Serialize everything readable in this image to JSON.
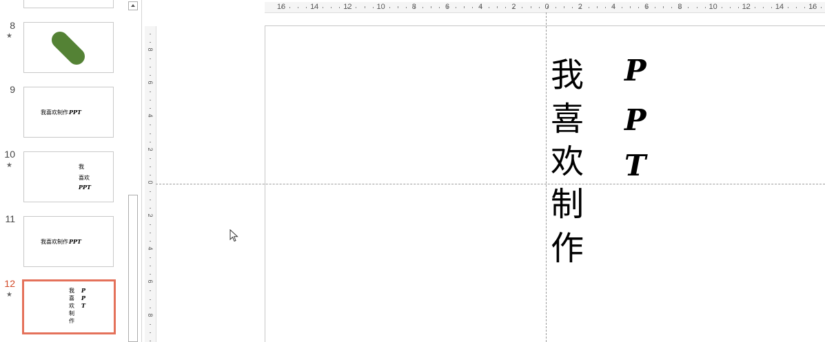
{
  "slides": [
    {
      "number": "8",
      "starred": true,
      "kind": "shape",
      "shape_color": "#548235"
    },
    {
      "number": "9",
      "starred": false,
      "kind": "text",
      "text": "我喜欢制作",
      "ppt": "PPT"
    },
    {
      "number": "10",
      "starred": true,
      "kind": "vertical-mixed",
      "lines": [
        "我",
        "喜欢"
      ],
      "ppt": "PPT"
    },
    {
      "number": "11",
      "starred": false,
      "kind": "text",
      "text": "我喜欢制作",
      "ppt": "PPT"
    },
    {
      "number": "12",
      "starred": true,
      "selected": true,
      "kind": "vertical",
      "chars": [
        "我",
        "喜",
        "欢",
        "制",
        "作"
      ],
      "ppt_chars": [
        "P",
        "P",
        "T"
      ]
    }
  ],
  "star_glyph": "★",
  "ruler": {
    "horizontal_labels": [
      "16",
      "14",
      "12",
      "10",
      "8",
      "6",
      "4",
      "2",
      "0",
      "2",
      "4",
      "6",
      "8",
      "10",
      "12",
      "14",
      "16"
    ],
    "vertical_labels": [
      "8",
      "6",
      "4",
      "2",
      "0",
      "2",
      "4",
      "6",
      "8"
    ]
  },
  "canvas": {
    "chars": [
      "我",
      "喜",
      "欢",
      "制",
      "作"
    ],
    "ppt_chars": [
      "P",
      "P",
      "T"
    ]
  },
  "colors": {
    "selected_border": "#e4715a",
    "selected_number": "#d24726",
    "shape_green": "#548235"
  }
}
